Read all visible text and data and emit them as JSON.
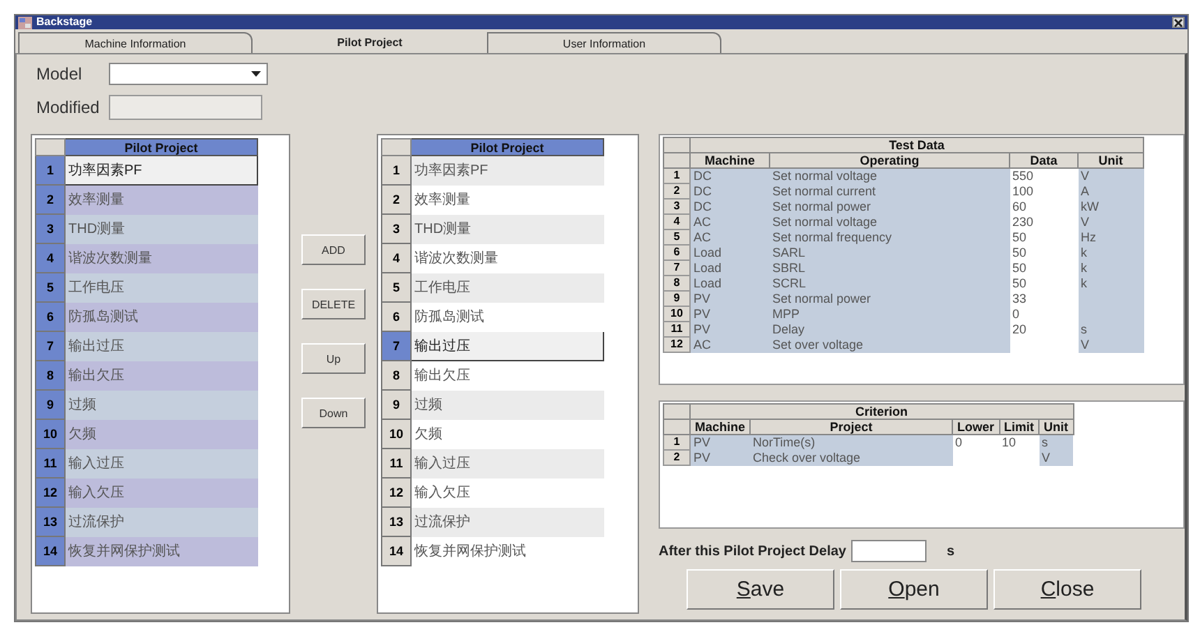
{
  "window": {
    "title": "Backstage"
  },
  "tabs": [
    {
      "label": "Machine Information",
      "selected": false
    },
    {
      "label": "Pilot Project",
      "selected": true
    },
    {
      "label": "User Information",
      "selected": false
    }
  ],
  "model": {
    "label": "Model"
  },
  "modified": {
    "label": "Modified"
  },
  "left_list": {
    "header": "Pilot Project",
    "rows": [
      {
        "no": "1",
        "name": "功率因素PF",
        "selected": true,
        "focused": true
      },
      {
        "no": "2",
        "name": "效率测量",
        "selected": true,
        "focused": false
      },
      {
        "no": "3",
        "name": "THD测量",
        "selected": true,
        "focused": false
      },
      {
        "no": "4",
        "name": "谐波次数测量",
        "selected": true,
        "focused": false
      },
      {
        "no": "5",
        "name": "工作电压",
        "selected": true,
        "focused": false
      },
      {
        "no": "6",
        "name": "防孤岛测试",
        "selected": true,
        "focused": false
      },
      {
        "no": "7",
        "name": "输出过压",
        "selected": true,
        "focused": false
      },
      {
        "no": "8",
        "name": "输出欠压",
        "selected": true,
        "focused": false
      },
      {
        "no": "9",
        "name": "过频",
        "selected": true,
        "focused": false
      },
      {
        "no": "10",
        "name": "欠频",
        "selected": true,
        "focused": false
      },
      {
        "no": "11",
        "name": "输入过压",
        "selected": true,
        "focused": false
      },
      {
        "no": "12",
        "name": "输入欠压",
        "selected": true,
        "focused": false
      },
      {
        "no": "13",
        "name": "过流保护",
        "selected": true,
        "focused": false
      },
      {
        "no": "14",
        "name": "恢复并网保护测试",
        "selected": true,
        "focused": false
      }
    ]
  },
  "actions": [
    "ADD",
    "DELETE",
    "Up",
    "Down"
  ],
  "middle_list": {
    "header": "Pilot Project",
    "rows": [
      {
        "no": "1",
        "name": "功率因素PF",
        "selected": false
      },
      {
        "no": "2",
        "name": "效率测量",
        "selected": false
      },
      {
        "no": "3",
        "name": "THD测量",
        "selected": false
      },
      {
        "no": "4",
        "name": "谐波次数测量",
        "selected": false
      },
      {
        "no": "5",
        "name": "工作电压",
        "selected": false
      },
      {
        "no": "6",
        "name": "防孤岛测试",
        "selected": false
      },
      {
        "no": "7",
        "name": "输出过压",
        "selected": true
      },
      {
        "no": "8",
        "name": "输出欠压",
        "selected": false
      },
      {
        "no": "9",
        "name": "过频",
        "selected": false
      },
      {
        "no": "10",
        "name": "欠频",
        "selected": false
      },
      {
        "no": "11",
        "name": "输入过压",
        "selected": false
      },
      {
        "no": "12",
        "name": "输入欠压",
        "selected": false
      },
      {
        "no": "13",
        "name": "过流保护",
        "selected": false
      },
      {
        "no": "14",
        "name": "恢复并网保护测试",
        "selected": false
      }
    ]
  },
  "test_data": {
    "title": "Test Data",
    "columns": [
      "Machine",
      "Operating",
      "Data",
      "Unit"
    ],
    "rows": [
      {
        "no": "1",
        "machine": "DC",
        "operating": "Set normal voltage",
        "data": "550",
        "unit": "V"
      },
      {
        "no": "2",
        "machine": "DC",
        "operating": "Set normal current",
        "data": "100",
        "unit": "A"
      },
      {
        "no": "3",
        "machine": "DC",
        "operating": "Set normal power",
        "data": "60",
        "unit": "kW"
      },
      {
        "no": "4",
        "machine": "AC",
        "operating": "Set normal voltage",
        "data": "230",
        "unit": "V"
      },
      {
        "no": "5",
        "machine": "AC",
        "operating": "Set normal frequency",
        "data": "50",
        "unit": "Hz"
      },
      {
        "no": "6",
        "machine": "Load",
        "operating": "SARL",
        "data": "50",
        "unit": "k"
      },
      {
        "no": "7",
        "machine": "Load",
        "operating": "SBRL",
        "data": "50",
        "unit": "k"
      },
      {
        "no": "8",
        "machine": "Load",
        "operating": "SCRL",
        "data": "50",
        "unit": "k"
      },
      {
        "no": "9",
        "machine": "PV",
        "operating": "Set normal power",
        "data": "33"
      },
      {
        "no": "10",
        "machine": "PV",
        "operating": "MPP",
        "data": "0"
      },
      {
        "no": "11",
        "machine": "PV",
        "operating": "Delay",
        "data": "20",
        "unit": "s"
      },
      {
        "no": "12",
        "machine": "AC",
        "operating": "Set over voltage",
        "unit": "V"
      }
    ]
  },
  "criterion": {
    "title": "Criterion",
    "columns": [
      "Machine",
      "Project",
      "Lower",
      "Limit",
      "Unit"
    ],
    "rows": [
      {
        "no": "1",
        "machine": "PV",
        "project": "NorTime(s)",
        "lower": "0",
        "limit": "10",
        "unit": "s"
      },
      {
        "no": "2",
        "machine": "PV",
        "project": "Check over voltage",
        "unit": "V"
      }
    ]
  },
  "delay": {
    "label": "After this Pilot Project Delay",
    "unit": "s"
  },
  "buttons": [
    "Save",
    "Open",
    "Close"
  ]
}
